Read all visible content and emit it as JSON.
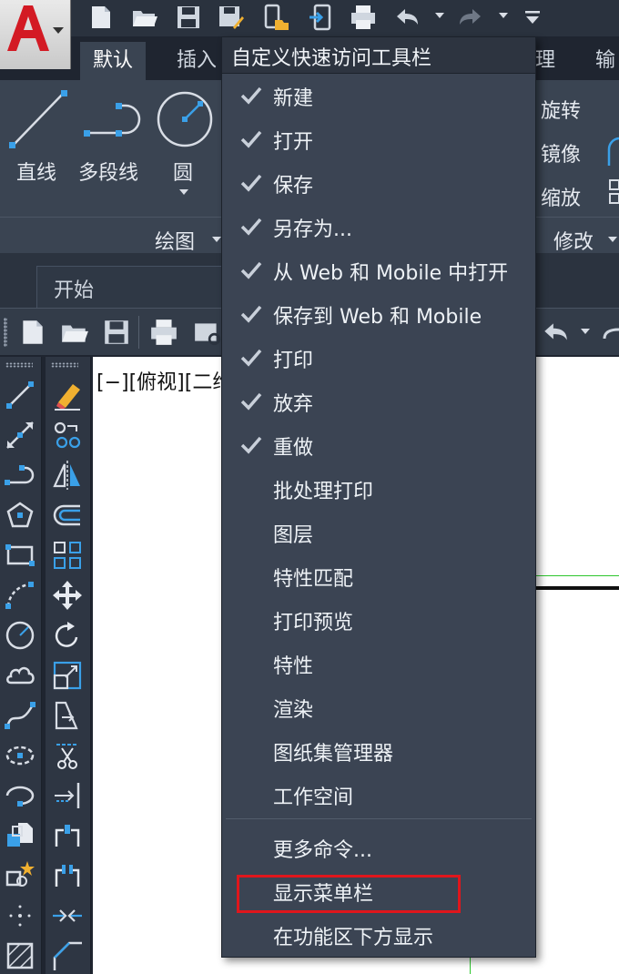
{
  "ribbon": {
    "tabs": [
      {
        "label": "默认"
      },
      {
        "label": "插入"
      },
      {
        "label": "理"
      },
      {
        "label": "输"
      }
    ],
    "draw_panel": {
      "tools": [
        {
          "label": "直线",
          "icon": "line-icon"
        },
        {
          "label": "多段线",
          "icon": "polyline-icon"
        },
        {
          "label": "圆",
          "icon": "circle-icon"
        }
      ],
      "title": "绘图"
    },
    "modify_panel": {
      "tools": [
        {
          "label": "旋转",
          "icon": "rotate-icon"
        },
        {
          "label": "镜像",
          "icon": "mirror-icon"
        },
        {
          "label": "缩放",
          "icon": "scale-icon"
        }
      ],
      "title": "修改"
    }
  },
  "doc_tab": {
    "label": "开始"
  },
  "viewport": {
    "label": "[−][俯视][二维"
  },
  "menu": {
    "title": "自定义快速访问工具栏",
    "items": [
      {
        "label": "新建",
        "checked": true
      },
      {
        "label": "打开",
        "checked": true
      },
      {
        "label": "保存",
        "checked": true
      },
      {
        "label": "另存为...",
        "checked": true
      },
      {
        "label": "从 Web 和 Mobile 中打开",
        "checked": true
      },
      {
        "label": "保存到 Web 和 Mobile",
        "checked": true
      },
      {
        "label": "打印",
        "checked": true
      },
      {
        "label": "放弃",
        "checked": true
      },
      {
        "label": "重做",
        "checked": true
      },
      {
        "label": "批处理打印",
        "checked": false
      },
      {
        "label": "图层",
        "checked": false
      },
      {
        "label": "特性匹配",
        "checked": false
      },
      {
        "label": "打印预览",
        "checked": false
      },
      {
        "label": "特性",
        "checked": false
      },
      {
        "label": "渲染",
        "checked": false
      },
      {
        "label": "图纸集管理器",
        "checked": false
      },
      {
        "label": "工作空间",
        "checked": false
      }
    ],
    "extra_items": [
      {
        "label": "更多命令..."
      },
      {
        "label": "显示菜单栏",
        "highlighted": true
      },
      {
        "label": "在功能区下方显示"
      }
    ]
  },
  "colors": {
    "accent": "#e0161c",
    "menu_bg": "#3b4453",
    "ribbon_bg": "#3a4452",
    "icon_blue": "#3aa0e8"
  }
}
